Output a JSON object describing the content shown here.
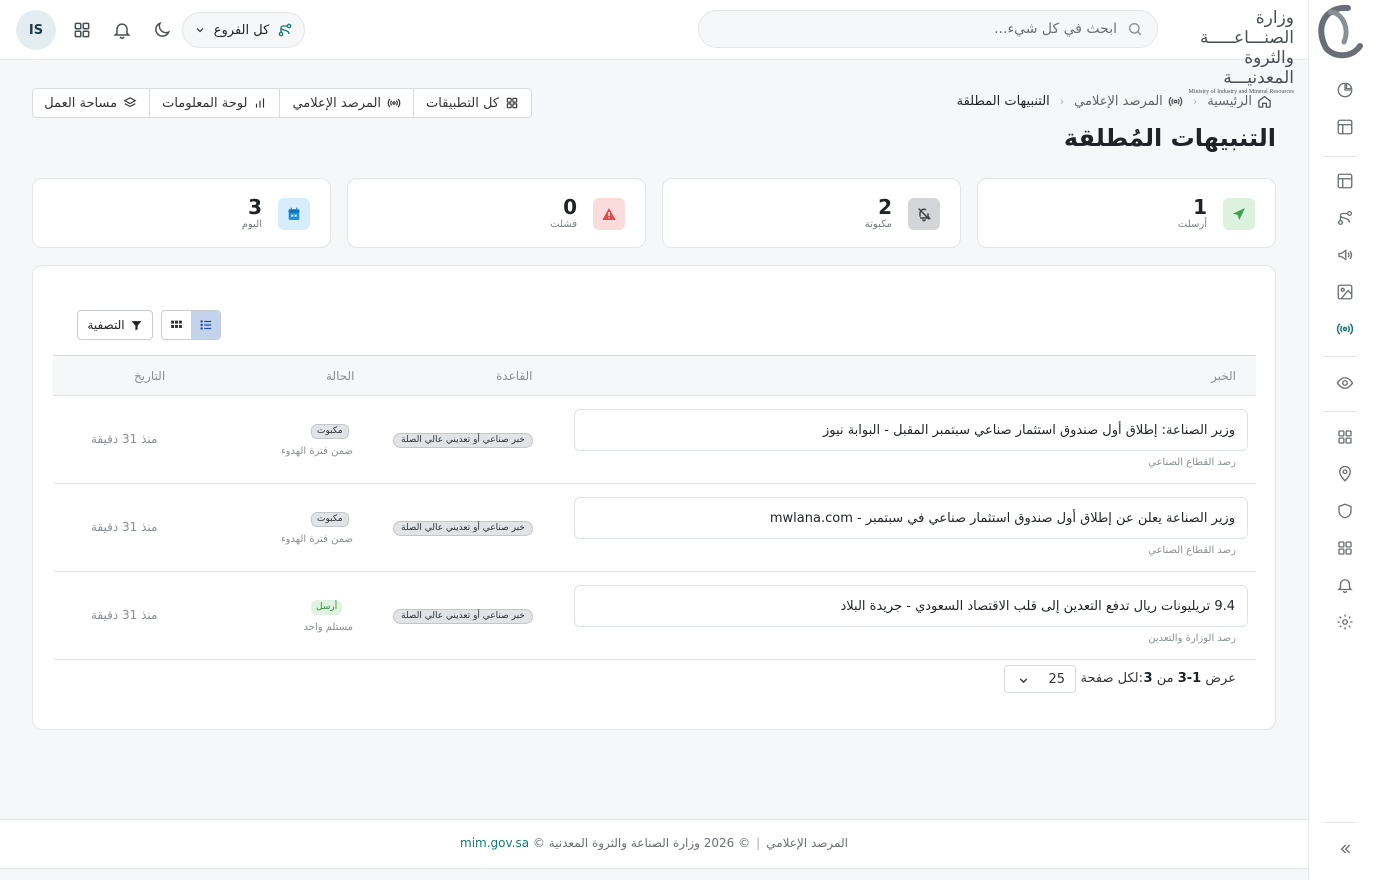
{
  "header": {
    "logo": {
      "line1": "وزارة الصنـــاعـــــة",
      "line2": "والثروة المعدنيـــة",
      "english": "Ministry of Industry and Mineral Resources"
    },
    "search_placeholder": "ابحث في كل شيء...",
    "branch_selector": "كل الفروع",
    "avatar_initials": "IS"
  },
  "breadcrumb": {
    "home": "الرئيسية",
    "section": "المرصد الإعلامي",
    "current": "التنبيهات المطلقة"
  },
  "page_title": "التنبيهات المُطلقة",
  "quick_nav": {
    "all_apps": "كل التطبيقات",
    "media_observatory": "المرصد الإعلامي",
    "dashboard": "لوحة المعلومات",
    "workspace": "مساحة العمل"
  },
  "stats": {
    "sent": {
      "value": "1",
      "label": "أرسلت",
      "color": "#3aa34a"
    },
    "stored": {
      "value": "2",
      "label": "مكبوتة",
      "color": "#5f6368"
    },
    "failed": {
      "value": "0",
      "label": "فشلت",
      "color": "#e5484d"
    },
    "today": {
      "value": "3",
      "label": "اليوم",
      "color": "#1f8fe0"
    }
  },
  "toolbar": {
    "filter_label": "التصفية"
  },
  "table": {
    "headers": {
      "news": "الخبر",
      "rule": "القاعدة",
      "status": "الحالة",
      "date": "التاريخ"
    },
    "rows": [
      {
        "title": "وزير الصناعة: إطلاق أول صندوق استثمار صناعي سبتمبر المقبل - البوابة نيوز",
        "source": "رصد القطاع الصناعي",
        "rule": "خبر صناعي أو تعديني عالي الصلة",
        "status": "مكبوت",
        "status_note": "ضمن فترة الهدوء",
        "date": "منذ 31 دقيقة"
      },
      {
        "title": "وزير الصناعة يعلن عن إطلاق أول صندوق استثمار صناعي في سبتمبر - mwlana.com",
        "source": "رصد القطاع الصناعي",
        "rule": "خبر صناعي أو تعديني عالي الصلة",
        "status": "مكبوت",
        "status_note": "ضمن فترة الهدوء",
        "date": "منذ 31 دقيقة"
      },
      {
        "title": "9.4 تريليونات ريال تدفع التعدين إلى قلب الاقتصاد السعودي - جريدة البلاد",
        "source": "رصد الوزارة والتعدين",
        "rule": "خبر صناعي أو تعديني عالي الصلة",
        "status": "أرسل",
        "status_note": "مستلم واحد",
        "date": "منذ 31 دقيقة"
      }
    ]
  },
  "pagination": {
    "showing_prefix": "عرض",
    "range": "1-3",
    "of_word": "من",
    "total": "3",
    "per_page_label": "لكل صفحة:",
    "per_page_value": "25"
  },
  "footer": {
    "site": "المرصد الإعلامي",
    "copyright": "© 2026 وزارة الصناعة والثروة المعدنية ©",
    "domain": "mim.gov.sa"
  },
  "colors": {
    "accent": "#157a6e",
    "active_toggle": "#c4d3ec"
  }
}
